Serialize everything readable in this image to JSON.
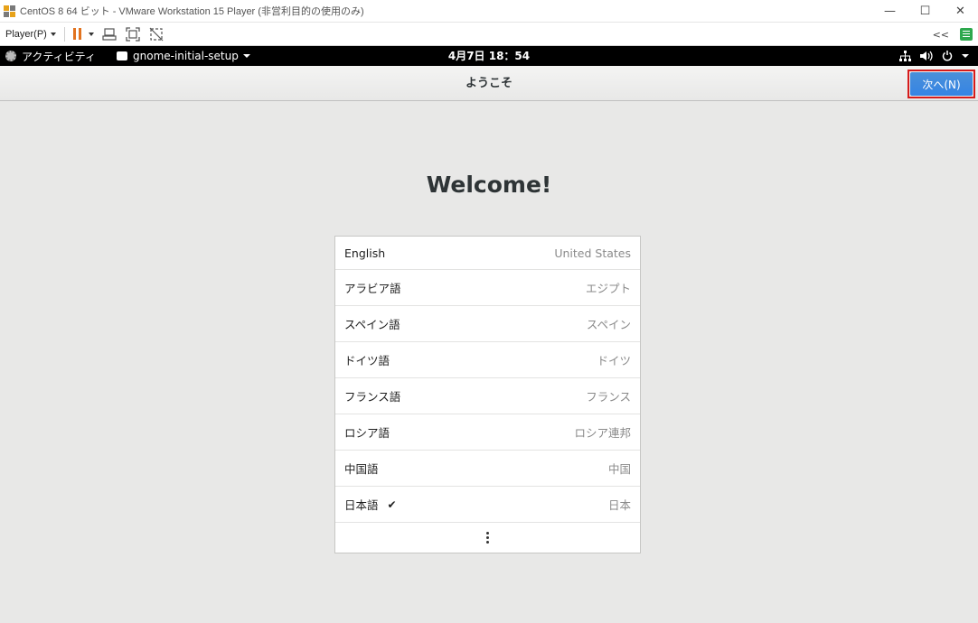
{
  "host_window": {
    "title": "CentOS 8 64 ビット - VMware Workstation 15 Player (非営利目的の使用のみ)",
    "controls": {
      "minimize": "—",
      "maximize": "☐",
      "close": "✕"
    }
  },
  "player_toolbar": {
    "menu_label": "Player(P)",
    "collapse_label": "<<",
    "icons": [
      "pause-icon",
      "send-ctrl-alt-del-icon",
      "fullscreen-icon",
      "unity-icon",
      "notes-icon"
    ]
  },
  "gnome_topbar": {
    "activities": "アクティビティ",
    "app_menu": "gnome-initial-setup",
    "clock": "4月7日  18：54",
    "tray_icons": [
      "network-icon",
      "volume-icon",
      "power-icon"
    ]
  },
  "header": {
    "title": "ようこそ",
    "next_button": "次へ(N)"
  },
  "main": {
    "heading": "Welcome!",
    "languages": [
      {
        "name": "English",
        "region": "United States",
        "selected": false
      },
      {
        "name": "アラビア語",
        "region": "エジプト",
        "selected": false
      },
      {
        "name": "スペイン語",
        "region": "スペイン",
        "selected": false
      },
      {
        "name": "ドイツ語",
        "region": "ドイツ",
        "selected": false
      },
      {
        "name": "フランス語",
        "region": "フランス",
        "selected": false
      },
      {
        "name": "ロシア語",
        "region": "ロシア連邦",
        "selected": false
      },
      {
        "name": "中国語",
        "region": "中国",
        "selected": false
      },
      {
        "name": "日本語",
        "region": "日本",
        "selected": true,
        "check": "✔"
      }
    ]
  },
  "colors": {
    "accent": "#3584e4",
    "highlight_border": "#d61b1b",
    "pause": "#e2731f"
  }
}
